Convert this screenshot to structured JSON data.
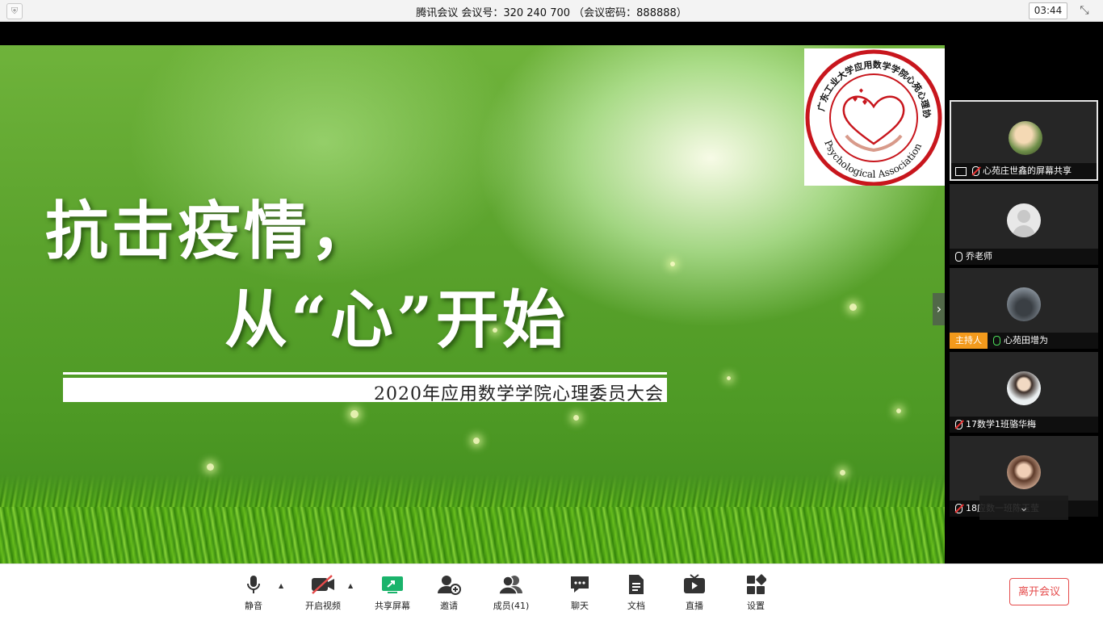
{
  "titlebar": {
    "title": "腾讯会议 会议号：320 240 700 （会议密码：888888）",
    "timer": "03:44",
    "shield_icon": "shield-icon",
    "fullscreen_icon": "exit-fullscreen-icon"
  },
  "slide": {
    "headline_line1": "抗击疫情，",
    "headline_line2": "从“心”开始",
    "banner_text": "2020年应用数学学院心理委员大会",
    "logo_text_cn": "广东工业大学应用数学学院心苑心理协会",
    "logo_text_en": "Psychological Association",
    "next_arrow": "›"
  },
  "participants": [
    {
      "name": "心苑庄世鑫的屏幕共享",
      "mic": "muted",
      "sharing": true,
      "selected": true,
      "avatar_color": "#8a9a6a"
    },
    {
      "name": "乔老师",
      "mic": "on",
      "host": false,
      "avatar_color": "#cfcfcf"
    },
    {
      "name": "心苑田增为",
      "mic": "active",
      "host_label": "主持人",
      "avatar_color": "#56606a"
    },
    {
      "name": "17数学1班骆华梅",
      "mic": "muted",
      "avatar_color": "#c9b9a3"
    },
    {
      "name": "18应数一班陈玉莹",
      "mic": "muted",
      "avatar_color": "#a47b62"
    }
  ],
  "scroll_down_label": "⌄",
  "toolbar": {
    "items": [
      {
        "label": "静音",
        "icon": "microphone-icon"
      },
      {
        "label": "开启视频",
        "icon": "video-off-icon"
      },
      {
        "label": "共享屏幕",
        "icon": "share-screen-icon"
      },
      {
        "label": "邀请",
        "icon": "invite-icon"
      },
      {
        "label": "成员(41)",
        "icon": "members-icon"
      },
      {
        "label": "聊天",
        "icon": "chat-icon"
      },
      {
        "label": "文档",
        "icon": "document-icon"
      },
      {
        "label": "直播",
        "icon": "live-icon"
      },
      {
        "label": "设置",
        "icon": "settings-icon"
      }
    ],
    "leave_label": "离开会议",
    "accent": "#1ab36b",
    "danger": "#e54b4b"
  }
}
